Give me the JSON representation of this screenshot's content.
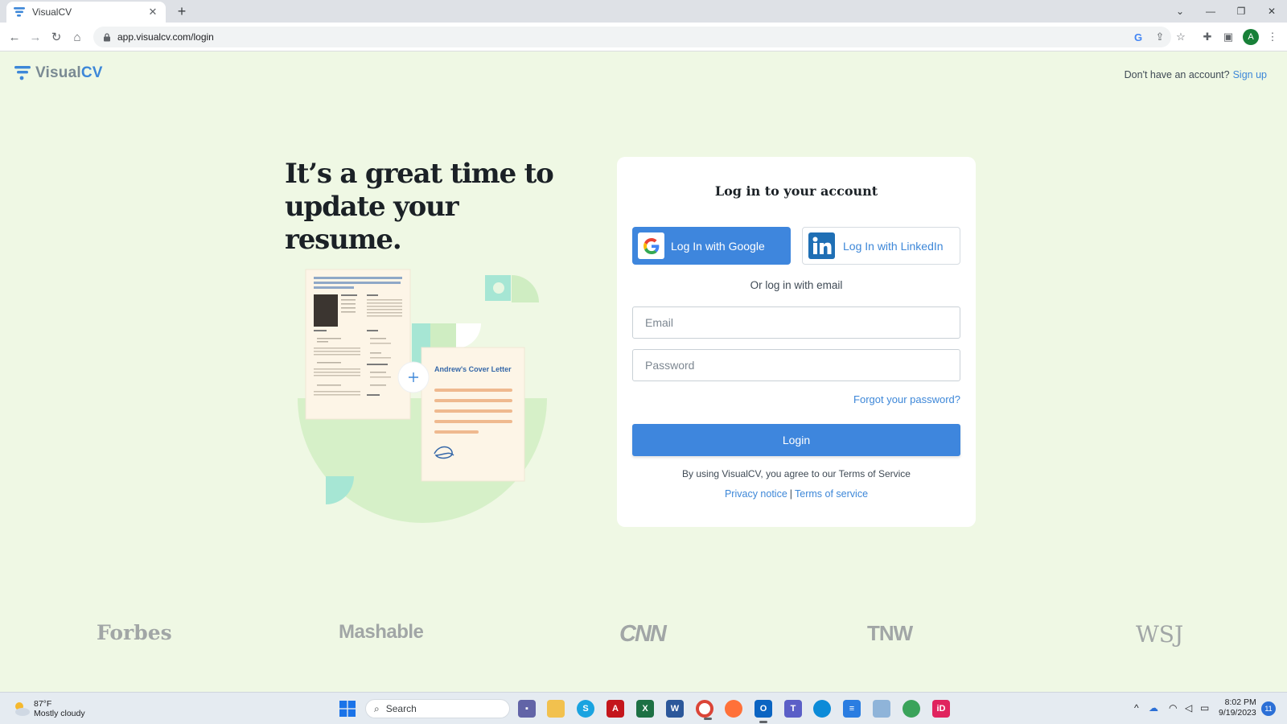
{
  "browser": {
    "tab_title": "VisualCV",
    "tab_close": "✕",
    "new_tab": "+",
    "url": "app.visualcv.com/login",
    "window_controls": [
      "⌄",
      "—",
      "❐",
      "✕"
    ],
    "profile_initial": "A"
  },
  "site": {
    "logo_visual": "Visual",
    "logo_cv": "CV",
    "no_account_text": "Don't have an account?",
    "signup_label": "Sign up",
    "headline": "It’s a great time to update your resume.",
    "cover_letter_title": "Andrew's Cover Letter",
    "press_logos": [
      "Forbes",
      "Mashable",
      "CNN",
      "TNW",
      "WSJ"
    ]
  },
  "login": {
    "title": "Log in to your account",
    "google_label": "Log In with Google",
    "linkedin_label": "Log In with LinkedIn",
    "or_text": "Or log in with email",
    "email_placeholder": "Email",
    "password_placeholder": "Password",
    "forgot_label": "Forgot your password?",
    "submit_label": "Login",
    "agree_text": "By using VisualCV, you agree to our Terms of Service",
    "privacy_label": "Privacy notice",
    "separator": "|",
    "terms_label": "Terms of service"
  },
  "taskbar": {
    "temperature": "87°F",
    "weather": "Mostly cloudy",
    "search_label": "Search",
    "time": "8:02 PM",
    "date": "9/19/2023",
    "notification_count": "11"
  },
  "colors": {
    "page_bg": "#eff8e4",
    "brand_blue": "#3e86dd",
    "link_blue": "#3d87d8",
    "mint": "#a6e6d4",
    "light_green": "#cfedc2"
  }
}
